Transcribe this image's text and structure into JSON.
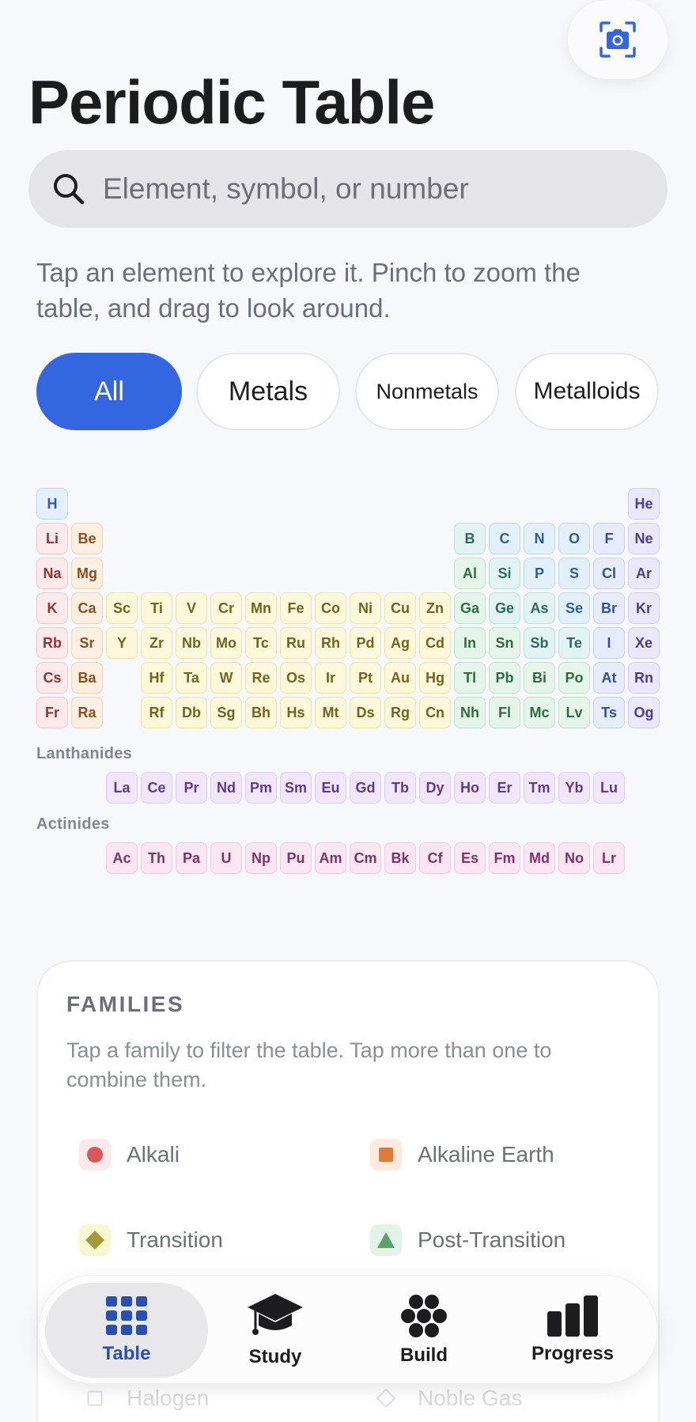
{
  "header": {
    "title": "Periodic Table",
    "camera_icon": "camera-icon"
  },
  "search": {
    "placeholder": "Element, symbol, or number",
    "value": "",
    "icon": "search-icon"
  },
  "hint": "Tap an element to explore it. Pinch to zoom the table, and drag to look around.",
  "filters": [
    {
      "label": "All",
      "active": true
    },
    {
      "label": "Metals",
      "active": false
    },
    {
      "label": "Nonmetals",
      "active": false
    },
    {
      "label": "Metalloids",
      "active": false
    }
  ],
  "colors": {
    "accent": "#3366e0",
    "alkali": {
      "bg": "#fdeaea",
      "border": "#f4c7c7",
      "text": "#8e3535"
    },
    "alkaline": {
      "bg": "#fdefe2",
      "border": "#f4d2b3",
      "text": "#8c4e1d"
    },
    "transition": {
      "bg": "#fdf8d9",
      "border": "#efe3a2",
      "text": "#6f6422"
    },
    "post": {
      "bg": "#e5f5ea",
      "border": "#bfe3c9",
      "text": "#2f6b40"
    },
    "metalloid": {
      "bg": "#e2f3f1",
      "border": "#b8e0da",
      "text": "#2a6961"
    },
    "nonmetal": {
      "bg": "#e3f0fb",
      "border": "#bcd8f1",
      "text": "#2d5f8e"
    },
    "halogen": {
      "bg": "#e6ecfb",
      "border": "#c3d0f2",
      "text": "#34508f"
    },
    "noble": {
      "bg": "#ece8fb",
      "border": "#d2c9f2",
      "text": "#4b3f8a"
    },
    "lanthanide": {
      "bg": "#f1e6fa",
      "border": "#dccaf0",
      "text": "#5d3b86"
    },
    "actinide": {
      "bg": "#fbe7f3",
      "border": "#f0c9e0",
      "text": "#7e3364"
    }
  },
  "elements": [
    {
      "s": "H",
      "r": 1,
      "c": 1,
      "g": "nonmetal"
    },
    {
      "s": "He",
      "r": 1,
      "c": 18,
      "g": "noble"
    },
    {
      "s": "Li",
      "r": 2,
      "c": 1,
      "g": "alkali"
    },
    {
      "s": "Be",
      "r": 2,
      "c": 2,
      "g": "alkaline"
    },
    {
      "s": "B",
      "r": 2,
      "c": 13,
      "g": "metalloid"
    },
    {
      "s": "C",
      "r": 2,
      "c": 14,
      "g": "nonmetal"
    },
    {
      "s": "N",
      "r": 2,
      "c": 15,
      "g": "nonmetal"
    },
    {
      "s": "O",
      "r": 2,
      "c": 16,
      "g": "nonmetal"
    },
    {
      "s": "F",
      "r": 2,
      "c": 17,
      "g": "halogen"
    },
    {
      "s": "Ne",
      "r": 2,
      "c": 18,
      "g": "noble"
    },
    {
      "s": "Na",
      "r": 3,
      "c": 1,
      "g": "alkali"
    },
    {
      "s": "Mg",
      "r": 3,
      "c": 2,
      "g": "alkaline"
    },
    {
      "s": "Al",
      "r": 3,
      "c": 13,
      "g": "post"
    },
    {
      "s": "Si",
      "r": 3,
      "c": 14,
      "g": "metalloid"
    },
    {
      "s": "P",
      "r": 3,
      "c": 15,
      "g": "nonmetal"
    },
    {
      "s": "S",
      "r": 3,
      "c": 16,
      "g": "nonmetal"
    },
    {
      "s": "Cl",
      "r": 3,
      "c": 17,
      "g": "halogen"
    },
    {
      "s": "Ar",
      "r": 3,
      "c": 18,
      "g": "noble"
    },
    {
      "s": "K",
      "r": 4,
      "c": 1,
      "g": "alkali"
    },
    {
      "s": "Ca",
      "r": 4,
      "c": 2,
      "g": "alkaline"
    },
    {
      "s": "Sc",
      "r": 4,
      "c": 3,
      "g": "transition"
    },
    {
      "s": "Ti",
      "r": 4,
      "c": 4,
      "g": "transition"
    },
    {
      "s": "V",
      "r": 4,
      "c": 5,
      "g": "transition"
    },
    {
      "s": "Cr",
      "r": 4,
      "c": 6,
      "g": "transition"
    },
    {
      "s": "Mn",
      "r": 4,
      "c": 7,
      "g": "transition"
    },
    {
      "s": "Fe",
      "r": 4,
      "c": 8,
      "g": "transition"
    },
    {
      "s": "Co",
      "r": 4,
      "c": 9,
      "g": "transition"
    },
    {
      "s": "Ni",
      "r": 4,
      "c": 10,
      "g": "transition"
    },
    {
      "s": "Cu",
      "r": 4,
      "c": 11,
      "g": "transition"
    },
    {
      "s": "Zn",
      "r": 4,
      "c": 12,
      "g": "transition"
    },
    {
      "s": "Ga",
      "r": 4,
      "c": 13,
      "g": "post"
    },
    {
      "s": "Ge",
      "r": 4,
      "c": 14,
      "g": "metalloid"
    },
    {
      "s": "As",
      "r": 4,
      "c": 15,
      "g": "metalloid"
    },
    {
      "s": "Se",
      "r": 4,
      "c": 16,
      "g": "nonmetal"
    },
    {
      "s": "Br",
      "r": 4,
      "c": 17,
      "g": "halogen"
    },
    {
      "s": "Kr",
      "r": 4,
      "c": 18,
      "g": "noble"
    },
    {
      "s": "Rb",
      "r": 5,
      "c": 1,
      "g": "alkali"
    },
    {
      "s": "Sr",
      "r": 5,
      "c": 2,
      "g": "alkaline"
    },
    {
      "s": "Y",
      "r": 5,
      "c": 3,
      "g": "transition"
    },
    {
      "s": "Zr",
      "r": 5,
      "c": 4,
      "g": "transition"
    },
    {
      "s": "Nb",
      "r": 5,
      "c": 5,
      "g": "transition"
    },
    {
      "s": "Mo",
      "r": 5,
      "c": 6,
      "g": "transition"
    },
    {
      "s": "Tc",
      "r": 5,
      "c": 7,
      "g": "transition"
    },
    {
      "s": "Ru",
      "r": 5,
      "c": 8,
      "g": "transition"
    },
    {
      "s": "Rh",
      "r": 5,
      "c": 9,
      "g": "transition"
    },
    {
      "s": "Pd",
      "r": 5,
      "c": 10,
      "g": "transition"
    },
    {
      "s": "Ag",
      "r": 5,
      "c": 11,
      "g": "transition"
    },
    {
      "s": "Cd",
      "r": 5,
      "c": 12,
      "g": "transition"
    },
    {
      "s": "In",
      "r": 5,
      "c": 13,
      "g": "post"
    },
    {
      "s": "Sn",
      "r": 5,
      "c": 14,
      "g": "post"
    },
    {
      "s": "Sb",
      "r": 5,
      "c": 15,
      "g": "metalloid"
    },
    {
      "s": "Te",
      "r": 5,
      "c": 16,
      "g": "metalloid"
    },
    {
      "s": "I",
      "r": 5,
      "c": 17,
      "g": "halogen"
    },
    {
      "s": "Xe",
      "r": 5,
      "c": 18,
      "g": "noble"
    },
    {
      "s": "Cs",
      "r": 6,
      "c": 1,
      "g": "alkali"
    },
    {
      "s": "Ba",
      "r": 6,
      "c": 2,
      "g": "alkaline"
    },
    {
      "s": "Hf",
      "r": 6,
      "c": 4,
      "g": "transition"
    },
    {
      "s": "Ta",
      "r": 6,
      "c": 5,
      "g": "transition"
    },
    {
      "s": "W",
      "r": 6,
      "c": 6,
      "g": "transition"
    },
    {
      "s": "Re",
      "r": 6,
      "c": 7,
      "g": "transition"
    },
    {
      "s": "Os",
      "r": 6,
      "c": 8,
      "g": "transition"
    },
    {
      "s": "Ir",
      "r": 6,
      "c": 9,
      "g": "transition"
    },
    {
      "s": "Pt",
      "r": 6,
      "c": 10,
      "g": "transition"
    },
    {
      "s": "Au",
      "r": 6,
      "c": 11,
      "g": "transition"
    },
    {
      "s": "Hg",
      "r": 6,
      "c": 12,
      "g": "transition"
    },
    {
      "s": "Tl",
      "r": 6,
      "c": 13,
      "g": "post"
    },
    {
      "s": "Pb",
      "r": 6,
      "c": 14,
      "g": "post"
    },
    {
      "s": "Bi",
      "r": 6,
      "c": 15,
      "g": "post"
    },
    {
      "s": "Po",
      "r": 6,
      "c": 16,
      "g": "post"
    },
    {
      "s": "At",
      "r": 6,
      "c": 17,
      "g": "halogen"
    },
    {
      "s": "Rn",
      "r": 6,
      "c": 18,
      "g": "noble"
    },
    {
      "s": "Fr",
      "r": 7,
      "c": 1,
      "g": "alkali"
    },
    {
      "s": "Ra",
      "r": 7,
      "c": 2,
      "g": "alkaline"
    },
    {
      "s": "Rf",
      "r": 7,
      "c": 4,
      "g": "transition"
    },
    {
      "s": "Db",
      "r": 7,
      "c": 5,
      "g": "transition"
    },
    {
      "s": "Sg",
      "r": 7,
      "c": 6,
      "g": "transition"
    },
    {
      "s": "Bh",
      "r": 7,
      "c": 7,
      "g": "transition"
    },
    {
      "s": "Hs",
      "r": 7,
      "c": 8,
      "g": "transition"
    },
    {
      "s": "Mt",
      "r": 7,
      "c": 9,
      "g": "transition"
    },
    {
      "s": "Ds",
      "r": 7,
      "c": 10,
      "g": "transition"
    },
    {
      "s": "Rg",
      "r": 7,
      "c": 11,
      "g": "transition"
    },
    {
      "s": "Cn",
      "r": 7,
      "c": 12,
      "g": "transition"
    },
    {
      "s": "Nh",
      "r": 7,
      "c": 13,
      "g": "post"
    },
    {
      "s": "Fl",
      "r": 7,
      "c": 14,
      "g": "post"
    },
    {
      "s": "Mc",
      "r": 7,
      "c": 15,
      "g": "post"
    },
    {
      "s": "Lv",
      "r": 7,
      "c": 16,
      "g": "post"
    },
    {
      "s": "Ts",
      "r": 7,
      "c": 17,
      "g": "halogen"
    },
    {
      "s": "Og",
      "r": 7,
      "c": 18,
      "g": "noble"
    }
  ],
  "lanthanides": {
    "label": "Lanthanides",
    "symbols": [
      "La",
      "Ce",
      "Pr",
      "Nd",
      "Pm",
      "Sm",
      "Eu",
      "Gd",
      "Tb",
      "Dy",
      "Ho",
      "Er",
      "Tm",
      "Yb",
      "Lu"
    ]
  },
  "actinides": {
    "label": "Actinides",
    "symbols": [
      "Ac",
      "Th",
      "Pa",
      "U",
      "Np",
      "Pu",
      "Am",
      "Cm",
      "Bk",
      "Cf",
      "Es",
      "Fm",
      "Md",
      "No",
      "Lr"
    ]
  },
  "families": {
    "title": "FAMILIES",
    "description": "Tap a family to filter the table. Tap more than one to combine them.",
    "items": [
      {
        "label": "Alkali",
        "icon": "circle-icon",
        "color": "#d9585a",
        "bg": "#fce9e9"
      },
      {
        "label": "Alkaline Earth",
        "icon": "square-icon",
        "color": "#e07a37",
        "bg": "#fcebdd"
      },
      {
        "label": "Transition",
        "icon": "diamond-icon",
        "color": "#a59a3a",
        "bg": "#fbf6d2"
      },
      {
        "label": "Post-Transition",
        "icon": "triangle-icon",
        "color": "#5aa06b",
        "bg": "#e2f3e7"
      },
      {
        "label": "Halogen",
        "icon": "square-outline-icon",
        "color": "#6d7fb8",
        "bg": "#ffffff"
      },
      {
        "label": "Noble Gas",
        "icon": "diamond-outline-icon",
        "color": "#8b7fc4",
        "bg": "#ffffff"
      }
    ]
  },
  "tabs": [
    {
      "label": "Table",
      "icon": "grid-icon",
      "active": true
    },
    {
      "label": "Study",
      "icon": "graduation-cap-icon",
      "active": false
    },
    {
      "label": "Build",
      "icon": "atom-cluster-icon",
      "active": false
    },
    {
      "label": "Progress",
      "icon": "bar-chart-icon",
      "active": false
    }
  ]
}
